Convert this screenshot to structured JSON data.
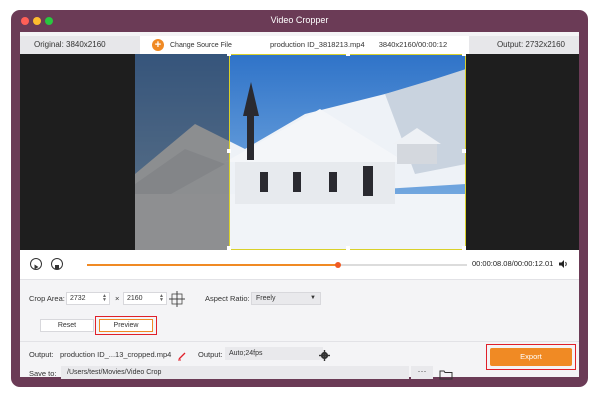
{
  "window": {
    "title": "Video Cropper"
  },
  "info": {
    "original": "Original: 3840x2160",
    "change_source": "Change Source File",
    "file_name": "production ID_3818213.mp4",
    "file_meta": "3840x2160/00:00:12",
    "output_res": "Output: 2732x2160"
  },
  "player": {
    "time": "00:00:08.08/00:00:12.01",
    "progress": 0.66
  },
  "crop": {
    "area_label": "Crop Area:",
    "width": "2732",
    "times": "×",
    "height": "2160",
    "aspect_label": "Aspect Ratio:",
    "aspect_value": "Freely",
    "reset_label": "Reset",
    "preview_label": "Preview"
  },
  "output": {
    "label": "Output:",
    "file": "production ID_...13_cropped.mp4",
    "settings_label": "Output:",
    "settings_value": "Auto;24fps",
    "save_label": "Save to:",
    "save_path": "/Users/test/Movies/Video Crop",
    "more": "···",
    "export_label": "Export"
  },
  "colors": {
    "accent": "#f08a24",
    "frame": "#6b3b56",
    "highlight": "#e0202a"
  }
}
